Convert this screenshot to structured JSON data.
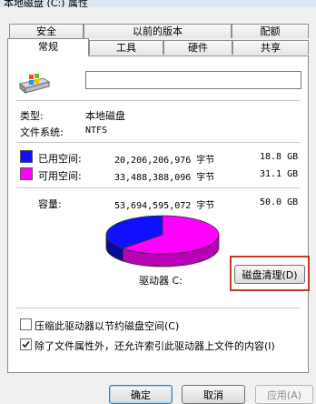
{
  "window": {
    "title": "本地磁盘 (C:) 属性"
  },
  "tabs_row1": [
    "安全",
    "以前的版本",
    "配额"
  ],
  "tabs_row2": [
    "常规",
    "工具",
    "硬件",
    "共享"
  ],
  "drive": {
    "name_value": "",
    "type_label": "类型:",
    "type_value": "本地磁盘",
    "fs_label": "文件系统:",
    "fs_value": "NTFS",
    "used": {
      "label": "已用空间:",
      "bytes": "20,206,206,976 字节",
      "size": "18.8 GB",
      "color": "#1010ff"
    },
    "free": {
      "label": "可用空间:",
      "bytes": "33,488,388,096 字节",
      "size": "31.1 GB",
      "color": "#ff00ff"
    },
    "capacity": {
      "label": "容量:",
      "bytes": "53,694,595,072 字节",
      "size": "50.0 GB"
    },
    "used_fraction": 0.376,
    "drive_label": "驱动器 C:",
    "cleanup_button": "磁盘清理(D)"
  },
  "options": {
    "compress": {
      "label": "压缩此驱动器以节约磁盘空间(C)",
      "checked": false
    },
    "index": {
      "label": "除了文件属性外，还允许索引此驱动器上文件的内容(I)",
      "checked": true
    }
  },
  "buttons": {
    "ok": "确定",
    "cancel": "取消",
    "apply": "应用(A)"
  }
}
